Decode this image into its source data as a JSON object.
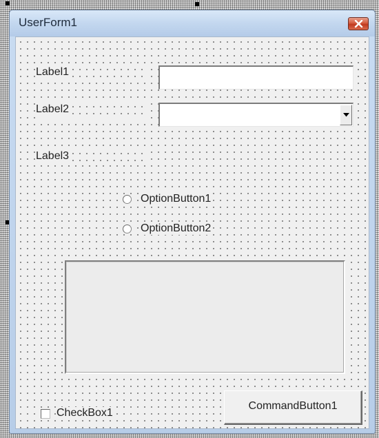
{
  "form": {
    "title": "UserForm1"
  },
  "controls": {
    "label1": "Label1",
    "label2": "Label2",
    "label3": "Label3",
    "textbox1_value": "",
    "combobox1_value": "",
    "option1": "OptionButton1",
    "option2": "OptionButton2",
    "checkbox1": "CheckBox1",
    "command_button1": "CommandButton1"
  },
  "icons": {
    "close": "close-icon",
    "dropdown": "chevron-down-icon"
  },
  "colors": {
    "titlebar": "#c3d7ef",
    "close_button": "#c9432a",
    "form_background": "#f0f0f0"
  }
}
